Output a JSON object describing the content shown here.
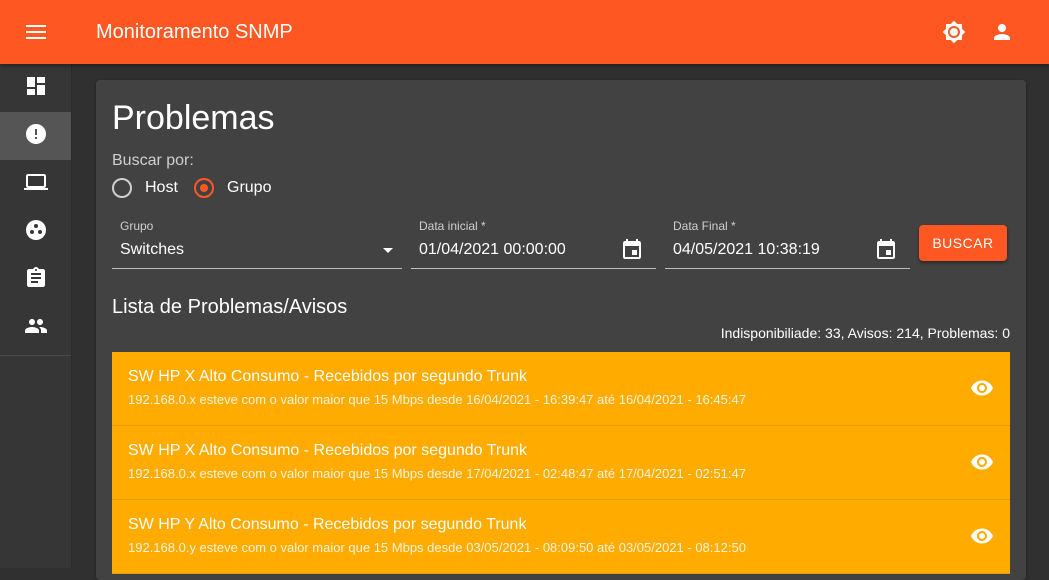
{
  "app": {
    "title": "Monitoramento SNMP"
  },
  "topbar": {
    "icons": [
      "menu-icon",
      "brightness-icon",
      "account-icon"
    ]
  },
  "sidebar": {
    "items": [
      {
        "icon": "dashboard-icon",
        "active": false
      },
      {
        "icon": "alert-icon",
        "active": true
      },
      {
        "icon": "laptop-icon",
        "active": false
      },
      {
        "icon": "hub-icon",
        "active": false
      },
      {
        "icon": "clipboard-icon",
        "active": false
      },
      {
        "icon": "people-icon",
        "active": false
      }
    ]
  },
  "page": {
    "title": "Problemas",
    "search_by_label": "Buscar por:",
    "radio_options": [
      {
        "label": "Host",
        "checked": false
      },
      {
        "label": "Grupo",
        "checked": true
      }
    ],
    "group_field": {
      "label": "Grupo",
      "value": "Switches"
    },
    "start_date": {
      "label": "Data inicial *",
      "value": "01/04/2021 00:00:00"
    },
    "end_date": {
      "label": "Data Final *",
      "value": "04/05/2021 10:38:19"
    },
    "search_button": "BUSCAR",
    "list_title": "Lista de Problemas/Avisos",
    "summary": "Indisponibiliade: 33, Avisos: 214, Problemas: 0",
    "items": [
      {
        "title": "SW HP X Alto Consumo - Recebidos por segundo Trunk",
        "subtitle": "192.168.0.x esteve com o valor maior que 15 Mbps desde 16/04/2021 - 16:39:47 até 16/04/2021 - 16:45:47"
      },
      {
        "title": "SW HP X Alto Consumo - Recebidos por segundo Trunk",
        "subtitle": "192.168.0.x esteve com o valor maior que 15 Mbps desde 17/04/2021 - 02:48:47 até 17/04/2021 - 02:51:47"
      },
      {
        "title": "SW HP Y Alto Consumo - Recebidos por segundo Trunk",
        "subtitle": "192.168.0.y esteve com o valor maior que 15 Mbps desde 03/05/2021 - 08:09:50 até 03/05/2021 - 08:12:50"
      }
    ]
  },
  "colors": {
    "primary": "#ff5722",
    "warning": "#ffab00",
    "background": "#303030",
    "card": "#424242",
    "sidebar": "#363636"
  }
}
